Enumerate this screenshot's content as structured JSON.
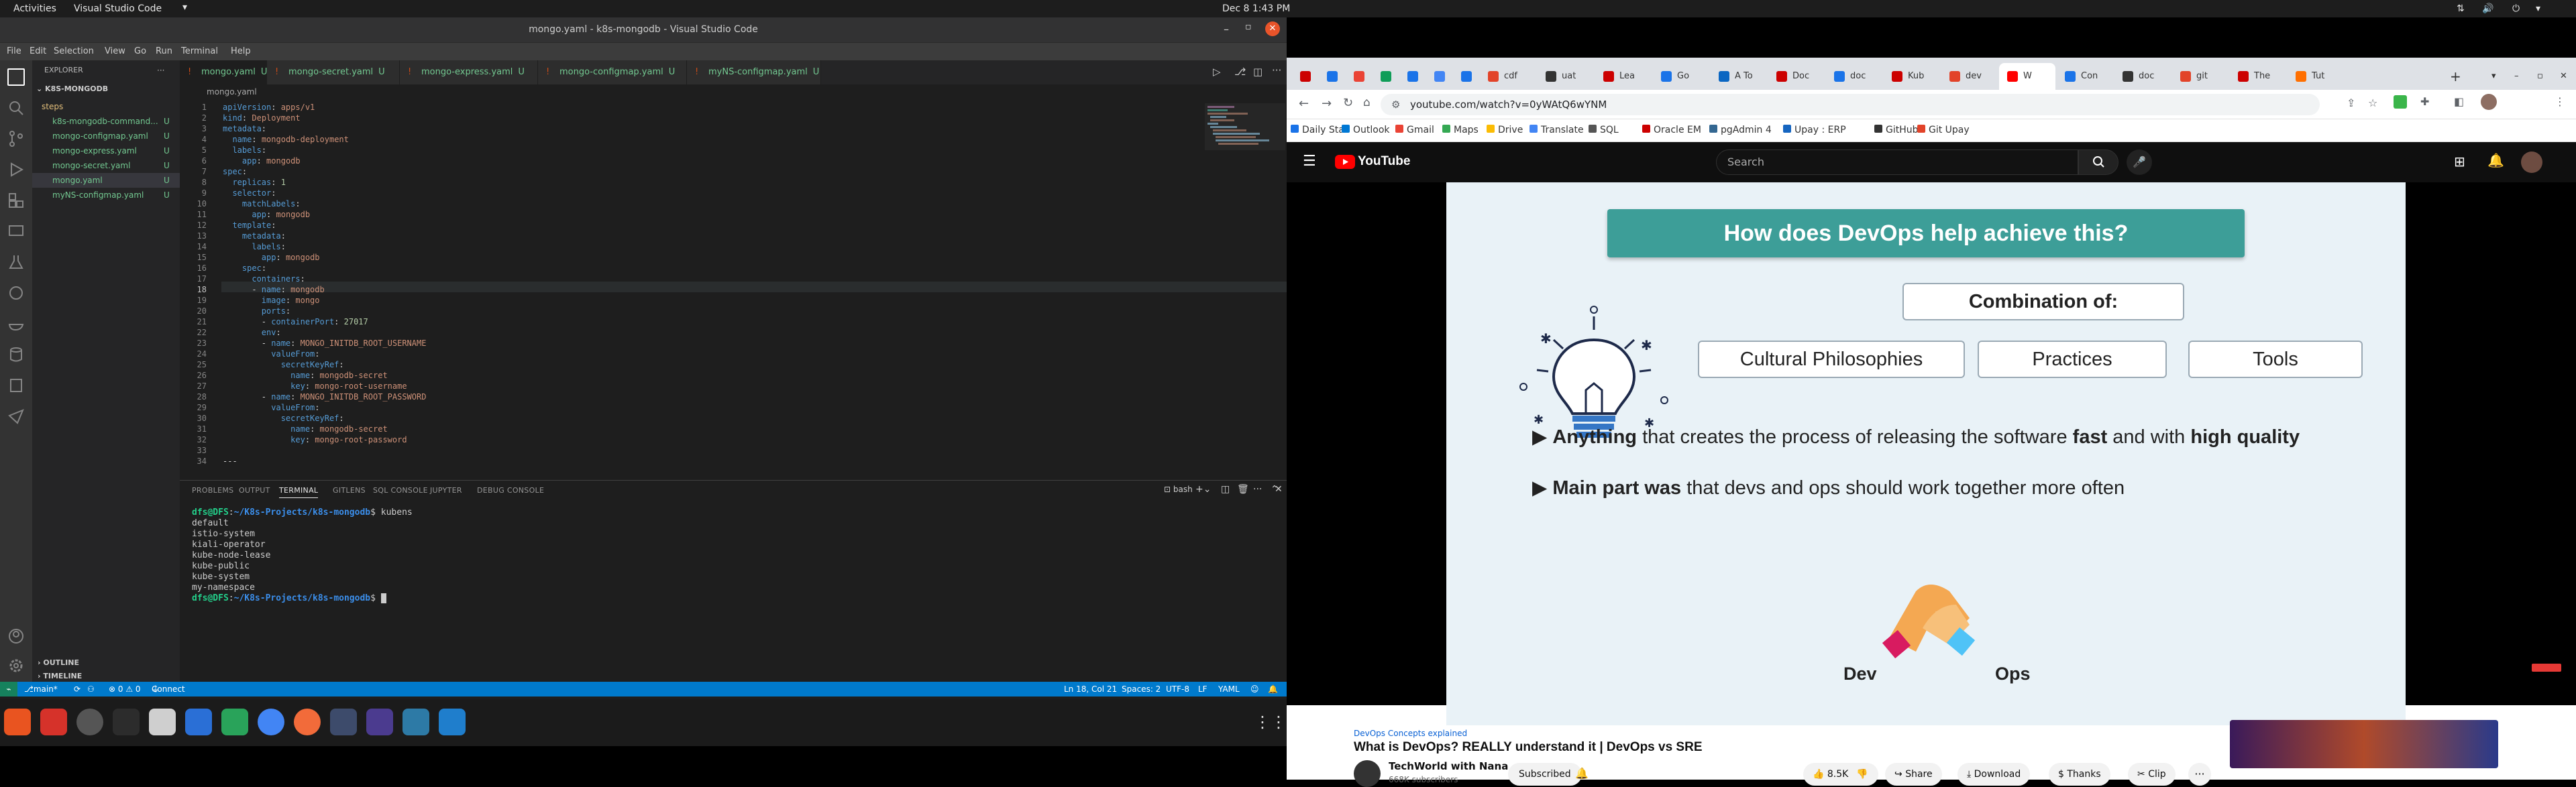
{
  "topbar": {
    "activities": "Activities",
    "app_name": "Visual Studio Code",
    "datetime": "Dec 8  1:43 PM"
  },
  "vscode": {
    "window_title": "mongo.yaml - k8s-mongodb - Visual Studio Code",
    "menu": [
      "File",
      "Edit",
      "Selection",
      "View",
      "Go",
      "Run",
      "Terminal",
      "Help"
    ],
    "explorer_title": "EXPLORER",
    "folder": "K8S-MONGODB",
    "files": [
      {
        "name": "steps",
        "status": "",
        "color": "#e5c07b"
      },
      {
        "name": "k8s-mongodb-command...",
        "status": "U",
        "color": "#73c991"
      },
      {
        "name": "mongo-configmap.yaml",
        "status": "U",
        "color": "#73c991"
      },
      {
        "name": "mongo-express.yaml",
        "status": "U",
        "color": "#73c991"
      },
      {
        "name": "mongo-secret.yaml",
        "status": "U",
        "color": "#73c991"
      },
      {
        "name": "mongo.yaml",
        "status": "U",
        "color": "#73c991"
      },
      {
        "name": "myNS-configmap.yaml",
        "status": "U",
        "color": "#73c991"
      }
    ],
    "outline": "OUTLINE",
    "timeline": "TIMELINE",
    "tabs": [
      {
        "label": "mongo.yaml",
        "status": "U"
      },
      {
        "label": "mongo-secret.yaml",
        "status": "U"
      },
      {
        "label": "mongo-express.yaml",
        "status": "U"
      },
      {
        "label": "mongo-configmap.yaml",
        "status": "U"
      },
      {
        "label": "myNS-configmap.yaml",
        "status": "U"
      }
    ],
    "breadcrumb": "mongo.yaml",
    "code_lines": [
      "apiVersion: apps/v1",
      "kind: Deployment",
      "metadata:",
      "  name: mongodb-deployment",
      "  labels:",
      "    app: mongodb",
      "spec:",
      "  replicas: 1",
      "  selector:",
      "    matchLabels:",
      "      app: mongodb",
      "  template:",
      "    metadata:",
      "      labels:",
      "        app: mongodb",
      "    spec:",
      "      containers:",
      "      - name: mongodb",
      "        image: mongo",
      "        ports:",
      "        - containerPort: 27017",
      "        env:",
      "        - name: MONGO_INITDB_ROOT_USERNAME",
      "          valueFrom:",
      "            secretKeyRef:",
      "              name: mongodb-secret",
      "              key: mongo-root-username",
      "        - name: MONGO_INITDB_ROOT_PASSWORD",
      "          valueFrom:",
      "            secretKeyRef:",
      "              name: mongodb-secret",
      "              key: mongo-root-password",
      "",
      "---"
    ],
    "panel_tabs": [
      "PROBLEMS",
      "OUTPUT",
      "TERMINAL",
      "GITLENS",
      "SQL CONSOLE",
      "JUPYTER",
      "DEBUG CONSOLE"
    ],
    "terminal_shell": "bash",
    "terminal_lines": [
      "dfs@DFS:~/K8s-Projects/k8s-mongodb$ kubens",
      "default",
      "istio-system",
      "kiali-operator",
      "kube-node-lease",
      "kube-public",
      "kube-system",
      "my-namespace",
      "dfs@DFS:~/K8s-Projects/k8s-mongodb$ "
    ],
    "status_left": {
      "branch": "main*",
      "problems": "⊗ 0  ⚠ 0",
      "connect": "Connect"
    },
    "status_right": {
      "position": "Ln 18, Col 21",
      "spaces": "Spaces: 2",
      "encoding": "UTF-8",
      "eol": "LF",
      "language": "YAML"
    }
  },
  "chrome": {
    "tabs": [
      "",
      "",
      "",
      "",
      "",
      "",
      "",
      "cdf",
      "uat",
      "Lea",
      "Go",
      "A To",
      "Doc",
      "doc",
      "Kub",
      "dev",
      "W",
      "Con",
      "doc",
      "git",
      "The",
      "Tut"
    ],
    "url": "youtube.com/watch?v=0yWAtQ6wYNM",
    "bookmarks": [
      "Daily Star",
      "Outlook",
      "Gmail",
      "Maps",
      "Drive",
      "Translate",
      "SQL",
      "Oracle EM",
      "pgAdmin 4",
      "Upay : ERP",
      "GitHub",
      "Git Upay"
    ]
  },
  "youtube": {
    "logo_text": "YouTube",
    "search_placeholder": "Search",
    "slide": {
      "title": "How does DevOps help achieve this?",
      "combo_label": "Combination of:",
      "chips": [
        "Cultural Philosophies",
        "Practices",
        "Tools"
      ],
      "bullet1": {
        "bold1": "Anything",
        "t1": " that creates the process of releasing the software ",
        "bold2": "fast",
        "t2": " and with ",
        "bold3": "high quality"
      },
      "bullet2": {
        "bold1": "Main part was",
        "t1": " that devs and ops should work together more often"
      },
      "dev": "Dev",
      "ops": "Ops"
    },
    "hashtag": "DevOps Concepts explained",
    "video_title": "What is DevOps? REALLY understand it | DevOps vs SRE",
    "channel": "TechWorld with Nana",
    "subscribers": "668K subscribers",
    "subscribed": "Subscribed",
    "likes": "8.5K",
    "share": "Share",
    "download": "Download",
    "thanks": "Thanks",
    "clip": "Clip"
  }
}
